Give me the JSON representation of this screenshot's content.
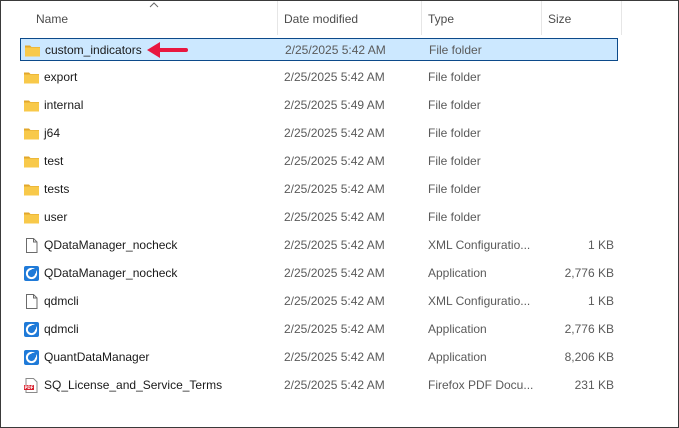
{
  "columns": {
    "name": "Name",
    "date": "Date modified",
    "type": "Type",
    "size": "Size"
  },
  "colors": {
    "folder": "#f8c94a",
    "selection_bg": "#cce8ff",
    "selection_border": "#0c4a8a",
    "annotation_arrow": "#e8173f"
  },
  "files": [
    {
      "name": "custom_indicators",
      "date": "2/25/2025 5:42 AM",
      "type": "File folder",
      "size": "",
      "icon": "folder-icon",
      "selected": true
    },
    {
      "name": "export",
      "date": "2/25/2025 5:42 AM",
      "type": "File folder",
      "size": "",
      "icon": "folder-icon"
    },
    {
      "name": "internal",
      "date": "2/25/2025 5:49 AM",
      "type": "File folder",
      "size": "",
      "icon": "folder-icon"
    },
    {
      "name": "j64",
      "date": "2/25/2025 5:42 AM",
      "type": "File folder",
      "size": "",
      "icon": "folder-icon"
    },
    {
      "name": "test",
      "date": "2/25/2025 5:42 AM",
      "type": "File folder",
      "size": "",
      "icon": "folder-icon"
    },
    {
      "name": "tests",
      "date": "2/25/2025 5:42 AM",
      "type": "File folder",
      "size": "",
      "icon": "folder-icon"
    },
    {
      "name": "user",
      "date": "2/25/2025 5:42 AM",
      "type": "File folder",
      "size": "",
      "icon": "folder-icon"
    },
    {
      "name": "QDataManager_nocheck",
      "date": "2/25/2025 5:42 AM",
      "type": "XML Configuratio...",
      "size": "1 KB",
      "icon": "document-icon"
    },
    {
      "name": "QDataManager_nocheck",
      "date": "2/25/2025 5:42 AM",
      "type": "Application",
      "size": "2,776 KB",
      "icon": "application-icon"
    },
    {
      "name": "qdmcli",
      "date": "2/25/2025 5:42 AM",
      "type": "XML Configuratio...",
      "size": "1 KB",
      "icon": "document-icon"
    },
    {
      "name": "qdmcli",
      "date": "2/25/2025 5:42 AM",
      "type": "Application",
      "size": "2,776 KB",
      "icon": "application-icon"
    },
    {
      "name": "QuantDataManager",
      "date": "2/25/2025 5:42 AM",
      "type": "Application",
      "size": "8,206 KB",
      "icon": "application-icon"
    },
    {
      "name": "SQ_License_and_Service_Terms",
      "date": "2/25/2025 5:42 AM",
      "type": "Firefox PDF Docu...",
      "size": "231 KB",
      "icon": "pdf-icon"
    }
  ]
}
